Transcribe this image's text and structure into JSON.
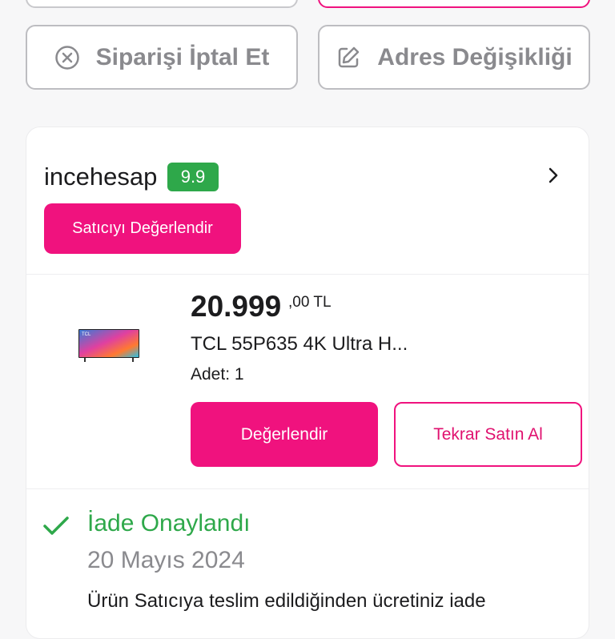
{
  "actions": {
    "cancel_label": "Siparişi İptal Et",
    "address_label": "Adres Değişikliği"
  },
  "seller": {
    "name": "incehesap",
    "score": "9.9",
    "rate_label": "Satıcıyı Değerlendir"
  },
  "product": {
    "price_main": "20.999",
    "price_fraction": ",00 TL",
    "title": "TCL 55P635 4K Ultra H...",
    "quantity": "Adet: 1",
    "rate_label": "Değerlendir",
    "rebuy_label": "Tekrar Satın Al",
    "thumb_brand": "TCL"
  },
  "status": {
    "title": "İade Onaylandı",
    "date": "20 Mayıs 2024",
    "description": "Ürün Satıcıya teslim edildiğinden ücretiniz iade"
  },
  "colors": {
    "brand_pink": "#f0127e",
    "success_green": "#2ea84a"
  },
  "icons": {
    "cancel": "x-circle-icon",
    "address": "edit-icon",
    "seller": "chevron-right-icon",
    "status": "check-icon"
  }
}
